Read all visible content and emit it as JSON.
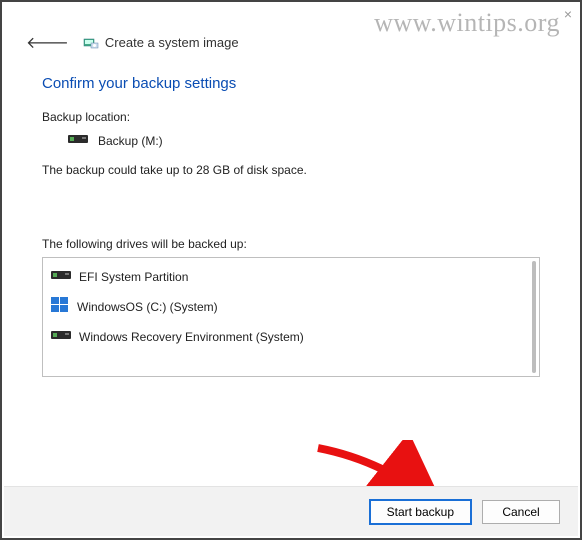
{
  "watermark": "www.wintips.org",
  "window": {
    "title": "Create a system image"
  },
  "heading": "Confirm your backup settings",
  "backup_location_label": "Backup location:",
  "backup_location_value": "Backup (M:)",
  "disk_space_text": "The backup could take up to 28 GB of disk space.",
  "drives_label": "The following drives will be backed up:",
  "drives": [
    {
      "label": "EFI System Partition",
      "icon": "hdd"
    },
    {
      "label": "WindowsOS (C:) (System)",
      "icon": "win"
    },
    {
      "label": "Windows Recovery Environment (System)",
      "icon": "hdd"
    }
  ],
  "buttons": {
    "start": "Start backup",
    "cancel": "Cancel"
  }
}
